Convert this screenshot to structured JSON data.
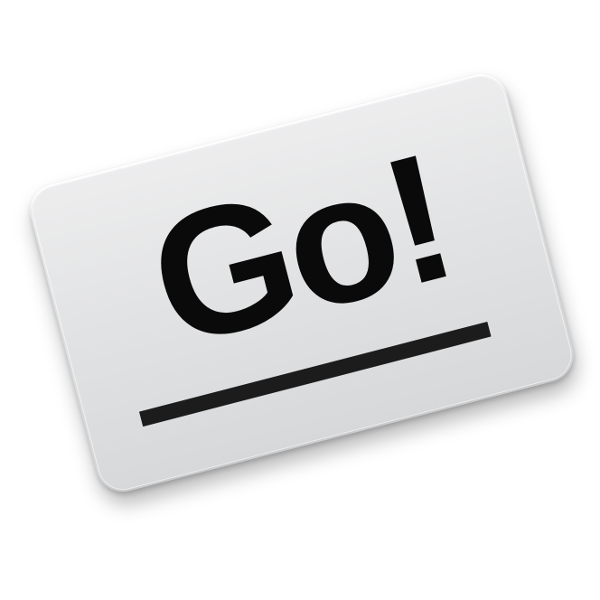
{
  "icon": {
    "text": "Go!"
  },
  "colors": {
    "card": "#e4e5e6",
    "text": "#0a0a0a",
    "underline": "#1c1c1c"
  }
}
